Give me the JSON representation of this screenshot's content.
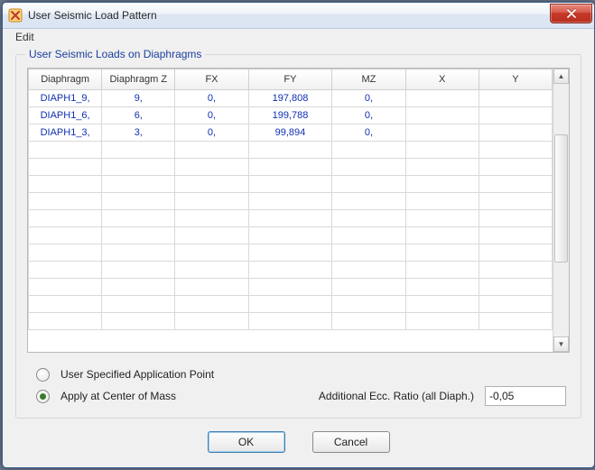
{
  "window": {
    "title": "User Seismic Load Pattern"
  },
  "menu": {
    "edit": "Edit"
  },
  "group": {
    "title": "User Seismic Loads on Diaphragms"
  },
  "table": {
    "headers": [
      "Diaphragm",
      "Diaphragm Z",
      "FX",
      "FY",
      "MZ",
      "X",
      "Y"
    ],
    "rows": [
      {
        "diaphragm": "DIAPH1_9,",
        "z": "9,",
        "fx": "0,",
        "fy": "197,808",
        "mz": "0,",
        "x": "",
        "y": ""
      },
      {
        "diaphragm": "DIAPH1_6,",
        "z": "6,",
        "fx": "0,",
        "fy": "199,788",
        "mz": "0,",
        "x": "",
        "y": ""
      },
      {
        "diaphragm": "DIAPH1_3,",
        "z": "3,",
        "fx": "0,",
        "fy": "99,894",
        "mz": "0,",
        "x": "",
        "y": ""
      }
    ]
  },
  "options": {
    "user_specified": "User Specified Application Point",
    "center_of_mass": "Apply at Center of Mass",
    "ecc_label": "Additional Ecc. Ratio (all Diaph.)",
    "ecc_value": "-0,05",
    "selected": "center_of_mass"
  },
  "buttons": {
    "ok": "OK",
    "cancel": "Cancel"
  },
  "scroll": {
    "up": "▲",
    "down": "▼"
  }
}
